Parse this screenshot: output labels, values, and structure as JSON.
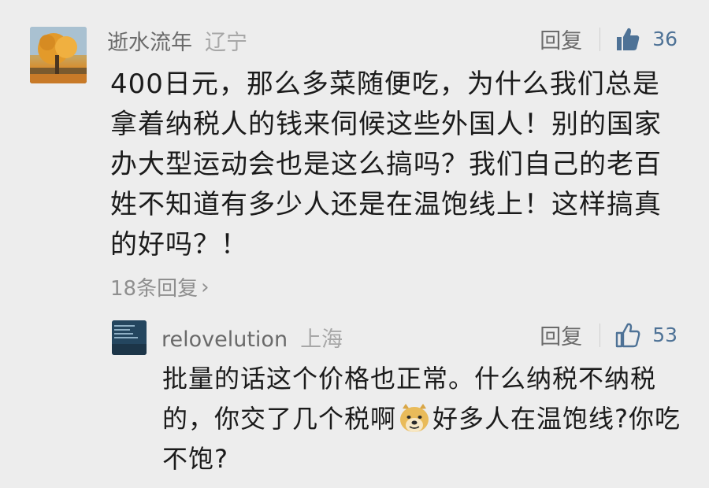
{
  "comment": {
    "username": "逝水流年",
    "location": "辽宁",
    "reply_label": "回复",
    "like_count": "36",
    "text": "400日元，那么多菜随便吃，为什么我们总是拿着纳税人的钱来伺候这些外国人！别的国家办大型运动会也是这么搞吗？我们自己的老百姓不知道有多少人还是在温饱线上！这样搞真的好吗？！",
    "replies_count_label": "18条回复",
    "replies_chevron": "›",
    "avatar_icon": "tree-avatar-icon",
    "like_icon": "thumbs-up-filled-icon"
  },
  "reply": {
    "username": "relovelution",
    "location": "上海",
    "reply_label": "回复",
    "like_count": "53",
    "text_before_emoji": "批量的话这个价格也正常。什么纳税不纳税的，你交了几个税啊",
    "text_after_emoji": "好多人在温饱线?你吃不饱?",
    "emoji_icon": "doge-emoji-icon",
    "avatar_icon": "blue-photo-avatar-icon",
    "like_icon": "thumbs-up-outline-icon",
    "like_color": "#4e7296"
  }
}
